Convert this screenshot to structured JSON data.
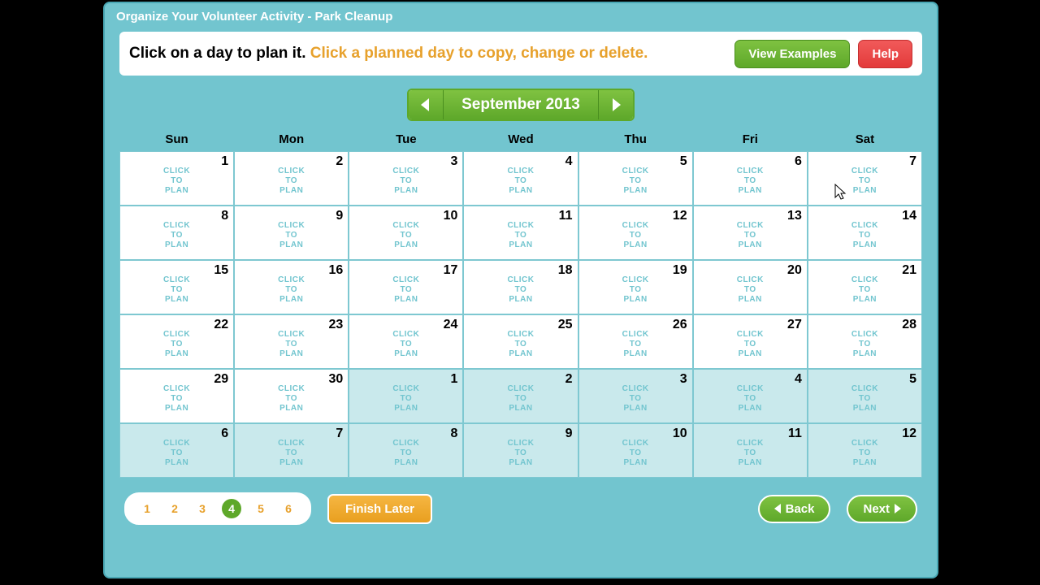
{
  "title": "Organize Your Volunteer Activity - Park Cleanup",
  "instruction": {
    "part1": "Click on a day to plan it. ",
    "part2": "Click a planned day to copy, change or delete."
  },
  "buttons": {
    "view_examples": "View Examples",
    "help": "Help",
    "finish_later": "Finish Later",
    "back": "Back",
    "next": "Next"
  },
  "month_label": "September 2013",
  "weekdays": [
    "Sun",
    "Mon",
    "Tue",
    "Wed",
    "Thu",
    "Fri",
    "Sat"
  ],
  "cell_label": "CLICK\nTO\nPLAN",
  "days": [
    {
      "n": 1,
      "other": false
    },
    {
      "n": 2,
      "other": false
    },
    {
      "n": 3,
      "other": false
    },
    {
      "n": 4,
      "other": false
    },
    {
      "n": 5,
      "other": false
    },
    {
      "n": 6,
      "other": false
    },
    {
      "n": 7,
      "other": false
    },
    {
      "n": 8,
      "other": false
    },
    {
      "n": 9,
      "other": false
    },
    {
      "n": 10,
      "other": false
    },
    {
      "n": 11,
      "other": false
    },
    {
      "n": 12,
      "other": false
    },
    {
      "n": 13,
      "other": false
    },
    {
      "n": 14,
      "other": false
    },
    {
      "n": 15,
      "other": false
    },
    {
      "n": 16,
      "other": false
    },
    {
      "n": 17,
      "other": false
    },
    {
      "n": 18,
      "other": false
    },
    {
      "n": 19,
      "other": false
    },
    {
      "n": 20,
      "other": false
    },
    {
      "n": 21,
      "other": false
    },
    {
      "n": 22,
      "other": false
    },
    {
      "n": 23,
      "other": false
    },
    {
      "n": 24,
      "other": false
    },
    {
      "n": 25,
      "other": false
    },
    {
      "n": 26,
      "other": false
    },
    {
      "n": 27,
      "other": false
    },
    {
      "n": 28,
      "other": false
    },
    {
      "n": 29,
      "other": false
    },
    {
      "n": 30,
      "other": false
    },
    {
      "n": 1,
      "other": true
    },
    {
      "n": 2,
      "other": true
    },
    {
      "n": 3,
      "other": true
    },
    {
      "n": 4,
      "other": true
    },
    {
      "n": 5,
      "other": true
    },
    {
      "n": 6,
      "other": true
    },
    {
      "n": 7,
      "other": true
    },
    {
      "n": 8,
      "other": true
    },
    {
      "n": 9,
      "other": true
    },
    {
      "n": 10,
      "other": true
    },
    {
      "n": 11,
      "other": true
    },
    {
      "n": 12,
      "other": true
    }
  ],
  "steps": {
    "items": [
      "1",
      "2",
      "3",
      "4",
      "5",
      "6"
    ],
    "active": 4
  }
}
